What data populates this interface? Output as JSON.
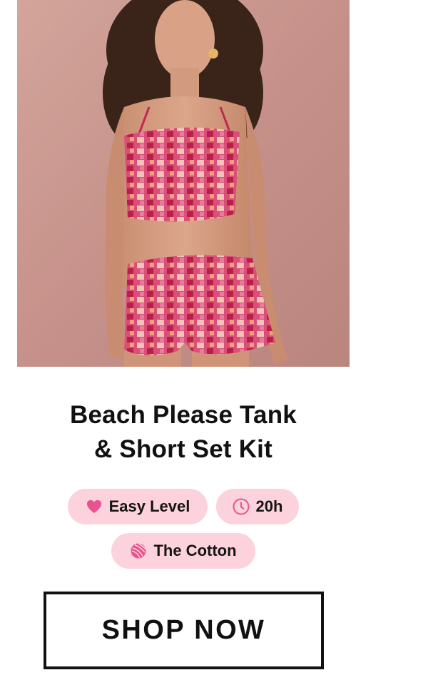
{
  "product": {
    "image_alt": "Model wearing a pink and cream space-dyed knit cropped tank top and matching shorts",
    "title_line1": "Beach Please Tank",
    "title_line2": "& Short Set Kit",
    "tags": {
      "level": {
        "label": "Easy Level",
        "icon": "heart-icon"
      },
      "time": {
        "label": "20h",
        "icon": "clock-icon"
      },
      "yarn": {
        "label": "The Cotton",
        "icon": "yarn-ball-icon"
      }
    },
    "cta_label": "SHOP NOW"
  },
  "colors": {
    "pill_background": "#fcd3dc",
    "accent_pink": "#e8528e",
    "photo_backdrop": "#c9968d",
    "button_border": "#111111"
  }
}
